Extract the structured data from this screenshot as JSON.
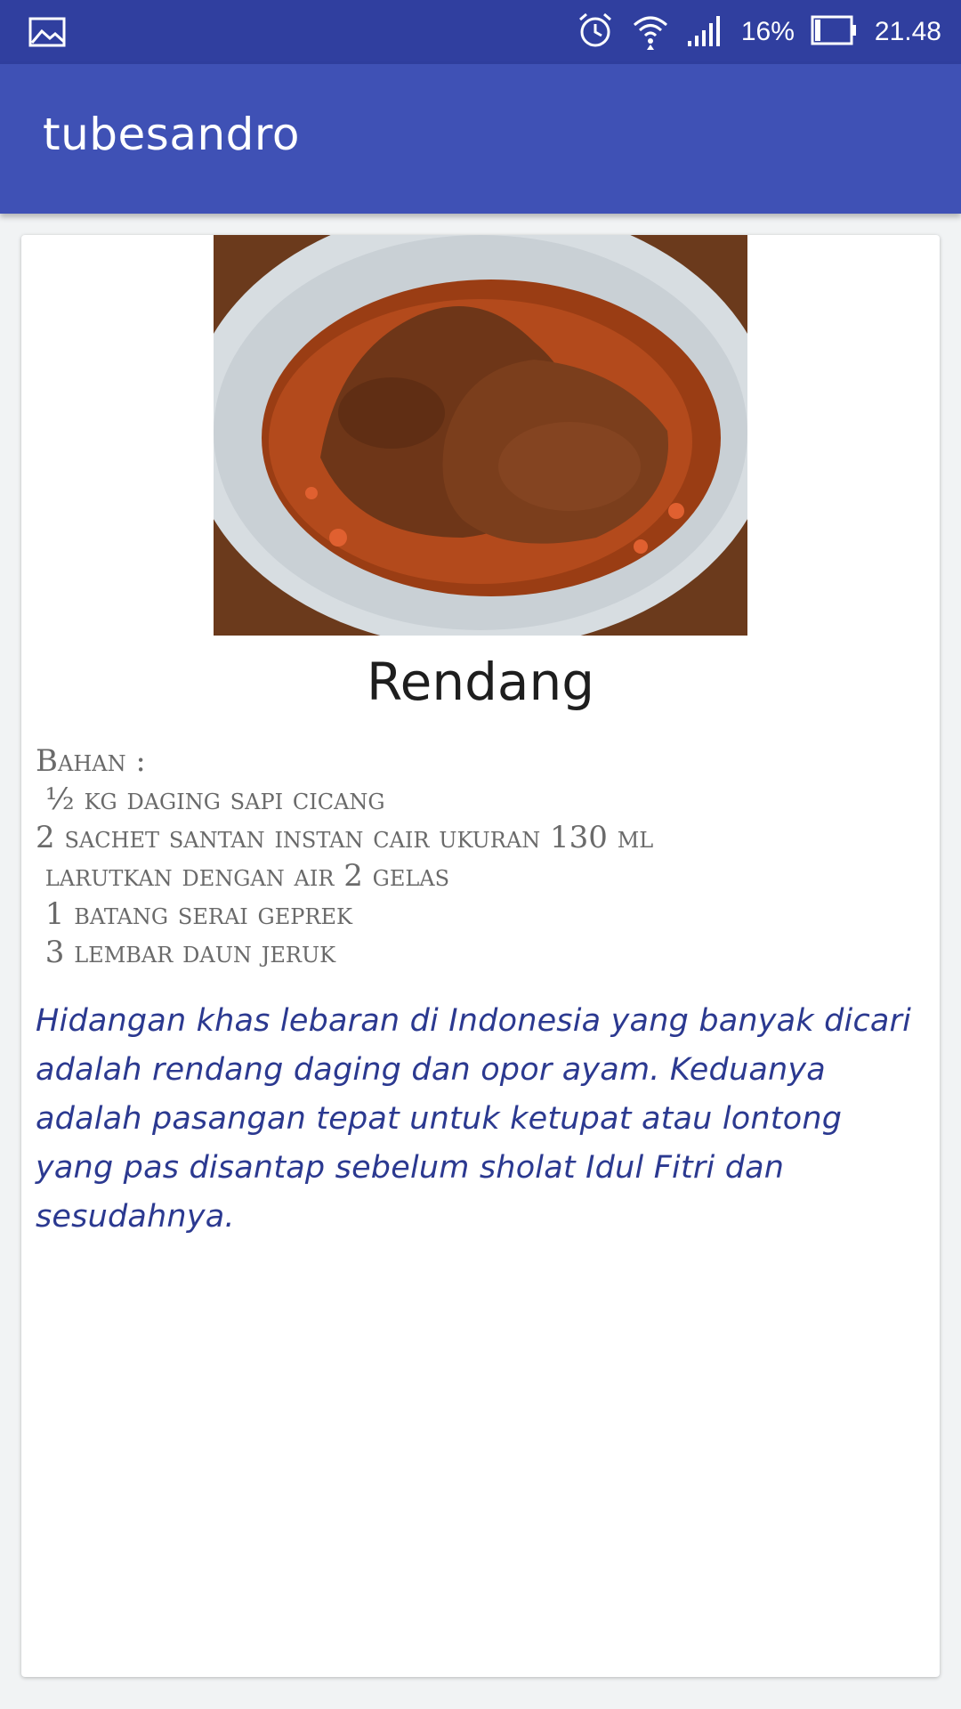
{
  "status_bar": {
    "battery": "16%",
    "time": "21.48",
    "icons": [
      "gallery-icon",
      "alarm-icon",
      "wifi-icon",
      "signal-icon",
      "battery-icon"
    ]
  },
  "app_bar": {
    "title": "tubesandro"
  },
  "recipe": {
    "image_icon": "food-image",
    "title": "Rendang",
    "ingredients": [
      "Bahan :",
      " ½ kg daging sapi cicang",
      "2 sachet santan instan cair ukuran 130 ml",
      " larutkan dengan air 2 gelas",
      " 1 batang serai geprek",
      " 3 lembar daun jeruk"
    ],
    "description": "Hidangan khas lebaran di Indonesia yang banyak dicari adalah rendang daging dan opor ayam. Keduanya adalah pasangan tepat untuk ketupat atau lontong yang pas disantap sebelum sholat Idul Fitri dan sesudahnya."
  },
  "colors": {
    "status_bar": "#303f9f",
    "app_bar": "#3f51b5",
    "description_text": "#2b3990",
    "ingredient_text": "#6a6a6a"
  }
}
